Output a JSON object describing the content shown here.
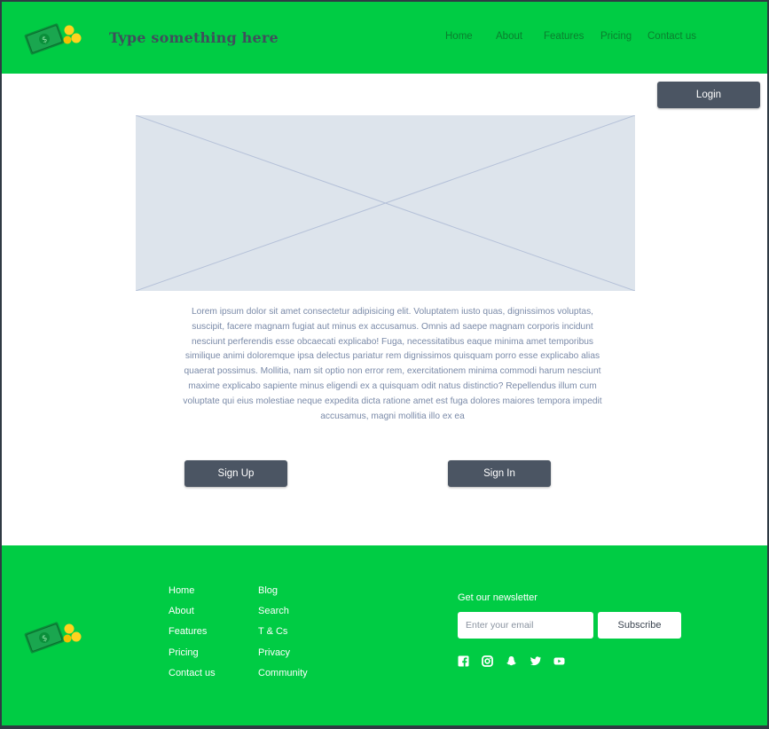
{
  "header": {
    "title": "Type something here",
    "nav": [
      "Home",
      "About",
      "Features",
      "Pricing",
      "Contact us"
    ]
  },
  "login_label": "Login",
  "main": {
    "body_text": "Lorem ipsum dolor sit amet consectetur adipisicing elit. Voluptatem iusto quas, dignissimos voluptas, suscipit, facere magnam fugiat aut minus ex accusamus. Omnis ad saepe magnam corporis incidunt nesciunt perferendis esse obcaecati explicabo! Fuga, necessitatibus eaque minima amet temporibus similique animi doloremque ipsa delectus pariatur rem dignissimos quisquam porro esse explicabo alias quaerat possimus. Mollitia, nam sit optio non error rem, exercitationem minima commodi harum nesciunt maxime explicabo sapiente minus eligendi ex a quisquam odit natus distinctio? Repellendus illum cum voluptate qui eius molestiae neque expedita dicta ratione amet est fuga dolores maiores tempora impedit accusamus, magni mollitia illo ex ea",
    "signup_label": "Sign Up",
    "signin_label": "Sign In"
  },
  "footer": {
    "col1": [
      "Home",
      "About",
      "Features",
      "Pricing",
      "Contact us"
    ],
    "col2": [
      "Blog",
      "Search",
      "T & Cs",
      "Privacy",
      "Community"
    ],
    "newsletter_label": "Get our newsletter",
    "email_placeholder": "Enter your email",
    "subscribe_label": "Subscribe",
    "social_icons": [
      "facebook-icon",
      "instagram-icon",
      "snapchat-icon",
      "twitter-icon",
      "youtube-icon"
    ]
  },
  "colors": {
    "brand_green": "#00cc44",
    "button_dark": "#4b5563",
    "placeholder_fill": "#dde4ec",
    "title_text": "#3f4f5c"
  }
}
